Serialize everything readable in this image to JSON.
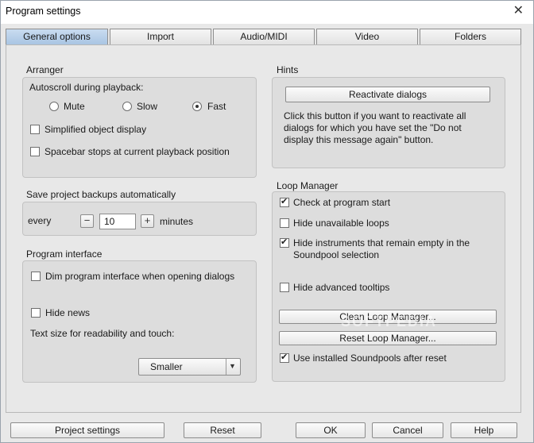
{
  "window": {
    "title": "Program settings",
    "close_glyph": "✕"
  },
  "tabs": [
    {
      "label": "General options",
      "active": true
    },
    {
      "label": "Import",
      "active": false
    },
    {
      "label": "Audio/MIDI",
      "active": false
    },
    {
      "label": "Video",
      "active": false
    },
    {
      "label": "Folders",
      "active": false
    }
  ],
  "arranger": {
    "title": "Arranger",
    "autoscroll_label": "Autoscroll during playback:",
    "options": [
      {
        "label": "Mute",
        "checked": false
      },
      {
        "label": "Slow",
        "checked": false
      },
      {
        "label": "Fast",
        "checked": true
      }
    ],
    "simplified_label": "Simplified object display",
    "simplified_checked": false,
    "spacebar_label": "Spacebar stops at current playback position",
    "spacebar_checked": false
  },
  "backups": {
    "title": "Save project backups automatically",
    "every_label": "every",
    "minus": "−",
    "value": "10",
    "plus": "+",
    "minutes_label": "minutes"
  },
  "interface": {
    "title": "Program interface",
    "dim_label": "Dim program interface when opening dialogs",
    "dim_checked": false,
    "hide_news_label": "Hide news",
    "hide_news_checked": false,
    "textsize_label": "Text size for readability and touch:",
    "textsize_value": "Smaller",
    "dropdown_arrow": "▼"
  },
  "hints": {
    "title": "Hints",
    "reactivate_button": "Reactivate dialogs",
    "description": "Click this button if you want to reactivate all dialogs for which you have set the \"Do not display this message again\" button."
  },
  "loop_manager": {
    "title": "Loop Manager",
    "check_start_label": "Check at program start",
    "check_start_checked": true,
    "hide_unavailable_label": "Hide unavailable loops",
    "hide_unavailable_checked": false,
    "hide_instruments_label": "Hide instruments that remain empty in the Soundpool selection",
    "hide_instruments_checked": true,
    "hide_tooltips_label": "Hide advanced tooltips",
    "hide_tooltips_checked": false,
    "clean_button": "Clean Loop Manager...",
    "reset_button": "Reset Loop Manager...",
    "use_installed_label": "Use installed Soundpools after reset",
    "use_installed_checked": true
  },
  "watermark": "SOFTPEDIA",
  "footer": {
    "project_settings": "Project settings",
    "reset": "Reset",
    "ok": "OK",
    "cancel": "Cancel",
    "help": "Help"
  }
}
